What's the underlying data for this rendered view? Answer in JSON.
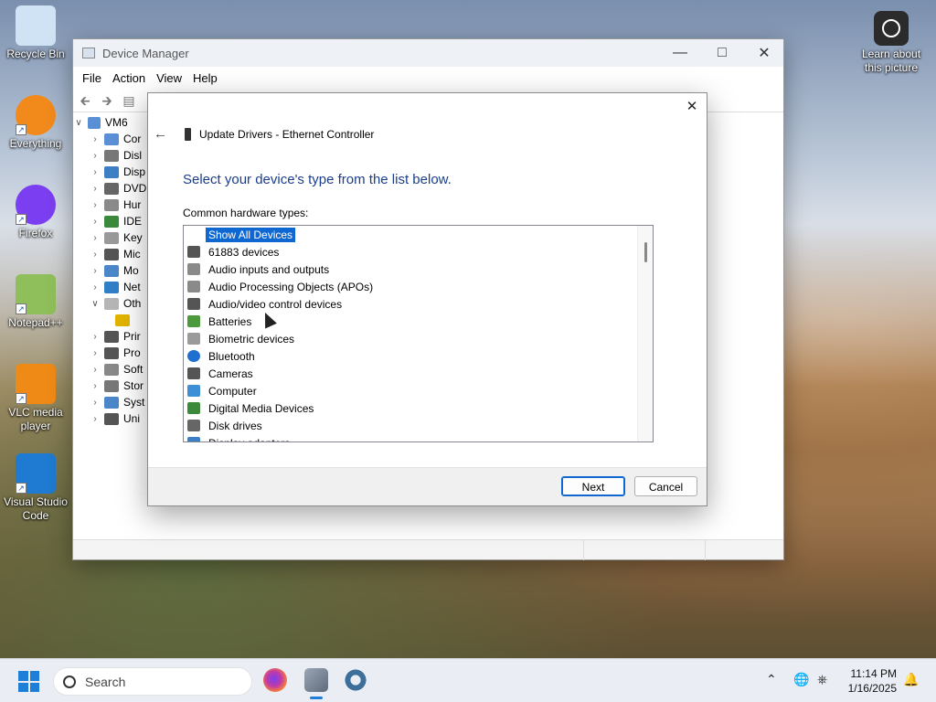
{
  "desktop": {
    "icons": [
      {
        "label": "Recycle Bin",
        "icon": "recycle-bin-icon"
      },
      {
        "label": "Everything",
        "icon": "everything-icon"
      },
      {
        "label": "Firefox",
        "icon": "firefox-icon"
      },
      {
        "label": "Notepad++",
        "icon": "notepad-plus-plus-icon"
      },
      {
        "label": "VLC media player",
        "icon": "vlc-icon"
      },
      {
        "label": "Visual Studio Code",
        "icon": "vscode-icon"
      }
    ],
    "learn_about": "Learn about this picture"
  },
  "device_manager": {
    "title": "Device Manager",
    "menu": [
      "File",
      "Action",
      "View",
      "Help"
    ],
    "tree": {
      "root": "VM6",
      "items": [
        {
          "label": "Cor",
          "color": "#5a8fd6"
        },
        {
          "label": "Disl",
          "color": "#777777"
        },
        {
          "label": "Disp",
          "color": "#3d7fc4"
        },
        {
          "label": "DVD",
          "color": "#666666"
        },
        {
          "label": "Hur",
          "color": "#8a8a8a"
        },
        {
          "label": "IDE",
          "color": "#3b8a3b"
        },
        {
          "label": "Key",
          "color": "#999999"
        },
        {
          "label": "Mic",
          "color": "#555555"
        },
        {
          "label": "Mo",
          "color": "#4a86c8"
        },
        {
          "label": "Net",
          "color": "#2f7fc6"
        },
        {
          "label": "Oth",
          "color": "#b5b5b5"
        },
        {
          "label": "",
          "color": "#e2b400"
        },
        {
          "label": "Prir",
          "color": "#555555"
        },
        {
          "label": "Pro",
          "color": "#555555"
        },
        {
          "label": "Soft",
          "color": "#888888"
        },
        {
          "label": "Stor",
          "color": "#777777"
        },
        {
          "label": "Syst",
          "color": "#4a86c8"
        },
        {
          "label": "Uni",
          "color": "#555555"
        }
      ]
    }
  },
  "dialog": {
    "title": "Update Drivers - Ethernet Controller",
    "heading": "Select your device's type from the list below.",
    "list_label": "Common hardware types:",
    "items": [
      {
        "label": "Show All Devices",
        "color": "transparent",
        "selected": true
      },
      {
        "label": "61883 devices",
        "color": "#555555"
      },
      {
        "label": "Audio inputs and outputs",
        "color": "#8a8a8a"
      },
      {
        "label": "Audio Processing Objects (APOs)",
        "color": "#8a8a8a"
      },
      {
        "label": "Audio/video control devices",
        "color": "#555555"
      },
      {
        "label": "Batteries",
        "color": "#4c9a3c"
      },
      {
        "label": "Biometric devices",
        "color": "#9a9a9a"
      },
      {
        "label": "Bluetooth",
        "color": "#1f6fd0"
      },
      {
        "label": "Cameras",
        "color": "#555555"
      },
      {
        "label": "Computer",
        "color": "#3d8fd6"
      },
      {
        "label": "Digital Media Devices",
        "color": "#3b8a3b"
      },
      {
        "label": "Disk drives",
        "color": "#666666"
      },
      {
        "label": "Display adapters",
        "color": "#3d7fc4"
      }
    ],
    "next_label": "Next",
    "cancel_label": "Cancel"
  },
  "taskbar": {
    "search_placeholder": "Search",
    "time": "11:14 PM",
    "date": "1/16/2025"
  }
}
